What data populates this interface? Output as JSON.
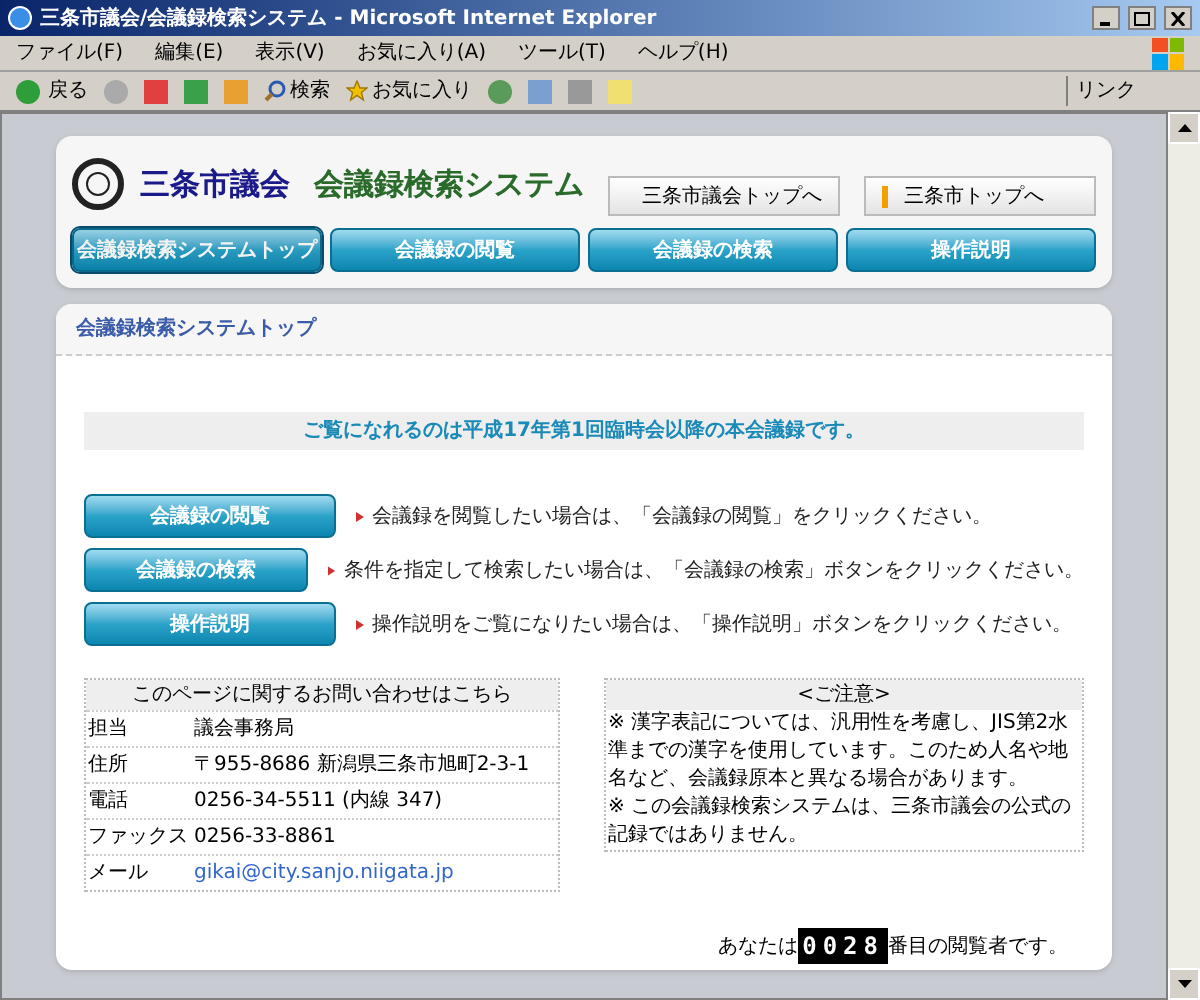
{
  "window": {
    "title": "三条市議会/会議録検索システム - Microsoft Internet Explorer"
  },
  "menu_bar": [
    "ファイル(F)",
    "編集(E)",
    "表示(V)",
    "お気に入り(A)",
    "ツール(T)",
    "ヘルプ(H)"
  ],
  "toolbar": {
    "back": "戻る",
    "search": "検索",
    "favorites": "お気に入り",
    "links": "リンク"
  },
  "header": {
    "title_org": "三条市議会",
    "title_system": "会議録検索システム",
    "links": [
      "三条市議会トップへ",
      "三条市トップへ"
    ],
    "nav": [
      {
        "label": "会議録検索システムトップ",
        "selected": true
      },
      {
        "label": "会議録の閲覧",
        "selected": false
      },
      {
        "label": "会議録の検索",
        "selected": false
      },
      {
        "label": "操作説明",
        "selected": false
      }
    ]
  },
  "page": {
    "heading": "会議録検索システムトップ",
    "notice": "ご覧になれるのは平成17年第1回臨時会以降の本会議録です。",
    "actions": [
      {
        "button": "会議録の閲覧",
        "description": "会議録を閲覧したい場合は、「会議録の閲覧」をクリックください。"
      },
      {
        "button": "会議録の検索",
        "description": "条件を指定して検索したい場合は、「会議録の検索」ボタンをクリックください。"
      },
      {
        "button": "操作説明",
        "description": "操作説明をご覧になりたい場合は、「操作説明」ボタンをクリックください。"
      }
    ],
    "contact": {
      "title": "このページに関するお問い合わせはこちら",
      "rows": [
        {
          "label": "担当",
          "value": "議会事務局",
          "kind": "text"
        },
        {
          "label": "住所",
          "value": "〒955-8686 新潟県三条市旭町2-3-1",
          "kind": "text"
        },
        {
          "label": "電話",
          "value": "0256-34-5511 (内線 347)",
          "kind": "text"
        },
        {
          "label": "ファックス",
          "value": "0256-33-8861",
          "kind": "text"
        },
        {
          "label": "メール",
          "value": "gikai@city.sanjo.niigata.jp",
          "kind": "link"
        }
      ]
    },
    "caution": {
      "title": "<ご注意>",
      "paragraphs": [
        "※ 漢字表記については、汎用性を考慮し、JIS第2水準までの漢字を使用しています。このため人名や地名など、会議録原本と異なる場合があります。",
        "※ この会議録検索システムは、三条市議会の公式の記録ではありません。"
      ]
    },
    "counter": {
      "prefix": "あなたは",
      "digits": [
        "0",
        "0",
        "2",
        "8"
      ],
      "suffix": "番目の閲覧者です。"
    }
  }
}
